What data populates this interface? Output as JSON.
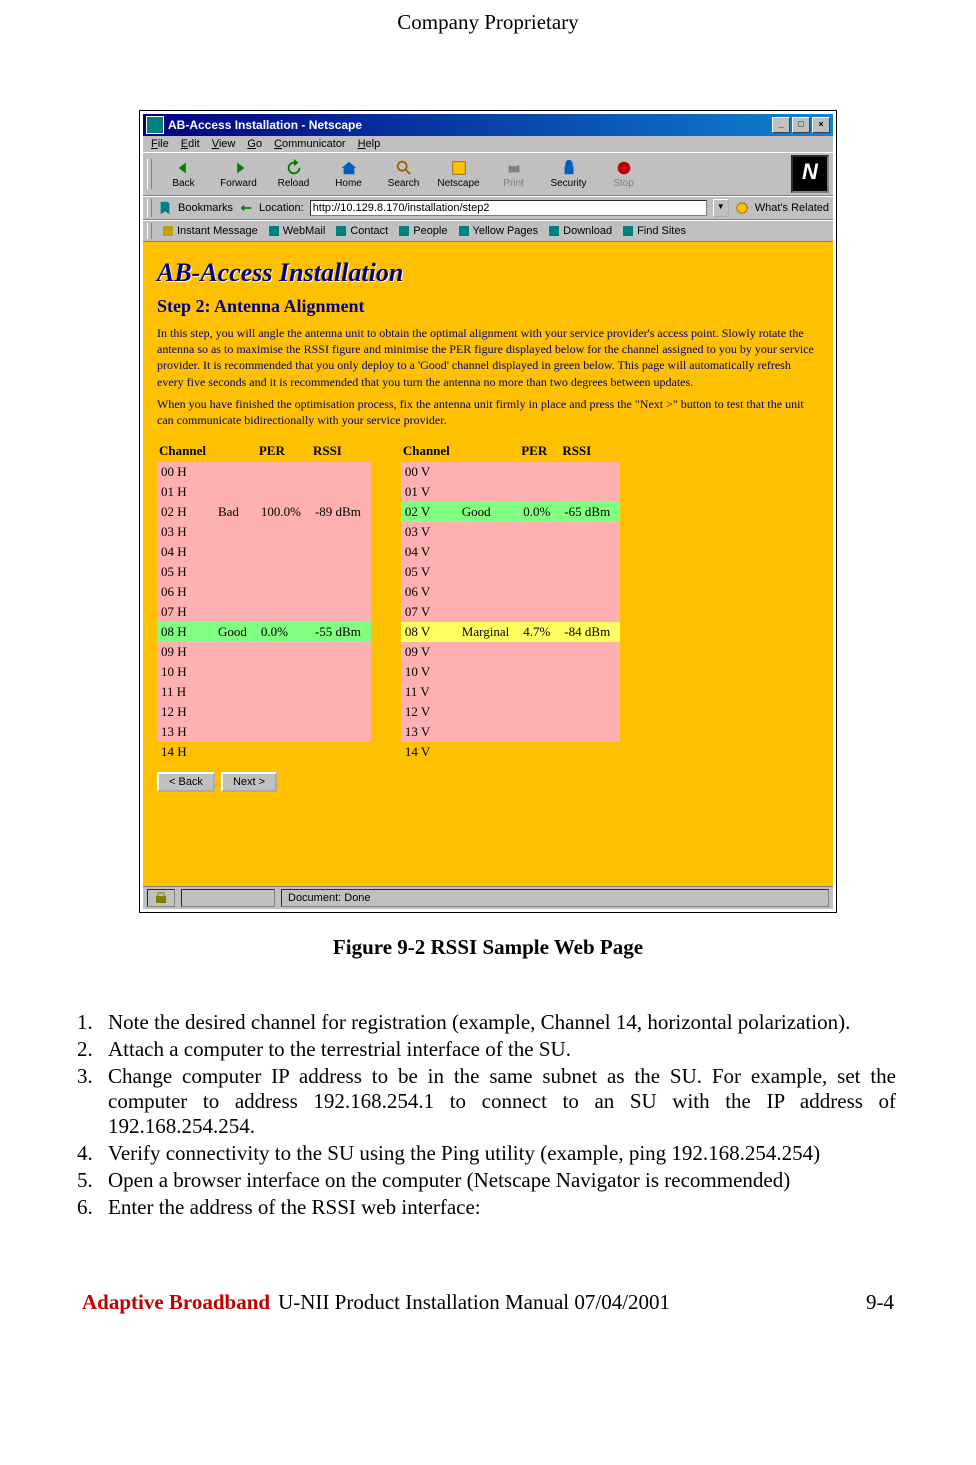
{
  "classification": "Company Proprietary",
  "window": {
    "title": "AB-Access Installation - Netscape",
    "menus": [
      "File",
      "Edit",
      "View",
      "Go",
      "Communicator",
      "Help"
    ],
    "toolbar": [
      {
        "label": "Back",
        "icon": "back"
      },
      {
        "label": "Forward",
        "icon": "forward"
      },
      {
        "label": "Reload",
        "icon": "reload"
      },
      {
        "label": "Home",
        "icon": "home"
      },
      {
        "label": "Search",
        "icon": "search"
      },
      {
        "label": "Netscape",
        "icon": "netscape"
      },
      {
        "label": "Print",
        "icon": "print",
        "disabled": true
      },
      {
        "label": "Security",
        "icon": "security"
      },
      {
        "label": "Stop",
        "icon": "stop",
        "disabled": true
      }
    ],
    "bookmarks_label": "Bookmarks",
    "location_label": "Location:",
    "location_value": "http://10.129.8.170/installation/step2",
    "whats_related": "What's Related",
    "linkbar": [
      "Instant Message",
      "WebMail",
      "Contact",
      "People",
      "Yellow Pages",
      "Download",
      "Find Sites"
    ],
    "status": "Document: Done"
  },
  "content": {
    "h1": "AB-Access Installation",
    "h2": "Step 2: Antenna Alignment",
    "p1": "In this step, you will angle the antenna unit to obtain the optimal alignment with your service provider's access point. Slowly rotate the antenna so as to maximise the RSSI figure and minimise the PER figure displayed below for the channel assigned to you by your service provider. It is recommended that you only deploy to a 'Good' channel displayed in green below. This page will automatically refresh every five seconds and it is recommended that you turn the antenna no more than two degrees between updates.",
    "p2": "When you have finished the optimisation process, fix the antenna unit firmly in place and press the \"Next >\" button to test that the unit can communicate bidirectionally with your service provider.",
    "headers": [
      "Channel",
      "PER",
      "RSSI"
    ],
    "left_rows": [
      {
        "ch": "00 H",
        "q": "",
        "per": "",
        "rssi": "",
        "cls": "pink"
      },
      {
        "ch": "01 H",
        "q": "",
        "per": "",
        "rssi": "",
        "cls": "pink"
      },
      {
        "ch": "02 H",
        "q": "Bad",
        "per": "100.0%",
        "rssi": "-89 dBm",
        "cls": "pink"
      },
      {
        "ch": "03 H",
        "q": "",
        "per": "",
        "rssi": "",
        "cls": "pink"
      },
      {
        "ch": "04 H",
        "q": "",
        "per": "",
        "rssi": "",
        "cls": "pink"
      },
      {
        "ch": "05 H",
        "q": "",
        "per": "",
        "rssi": "",
        "cls": "pink"
      },
      {
        "ch": "06 H",
        "q": "",
        "per": "",
        "rssi": "",
        "cls": "pink"
      },
      {
        "ch": "07 H",
        "q": "",
        "per": "",
        "rssi": "",
        "cls": "pink"
      },
      {
        "ch": "08 H",
        "q": "Good",
        "per": "0.0%",
        "rssi": "-55 dBm",
        "cls": "green"
      },
      {
        "ch": "09 H",
        "q": "",
        "per": "",
        "rssi": "",
        "cls": "pink"
      },
      {
        "ch": "10 H",
        "q": "",
        "per": "",
        "rssi": "",
        "cls": "pink"
      },
      {
        "ch": "11 H",
        "q": "",
        "per": "",
        "rssi": "",
        "cls": "pink"
      },
      {
        "ch": "12 H",
        "q": "",
        "per": "",
        "rssi": "",
        "cls": "pink"
      },
      {
        "ch": "13 H",
        "q": "",
        "per": "",
        "rssi": "",
        "cls": "pink"
      },
      {
        "ch": "14 H",
        "q": "",
        "per": "",
        "rssi": "",
        "cls": ""
      }
    ],
    "right_rows": [
      {
        "ch": "00 V",
        "q": "",
        "per": "",
        "rssi": "",
        "cls": "pink"
      },
      {
        "ch": "01 V",
        "q": "",
        "per": "",
        "rssi": "",
        "cls": "pink"
      },
      {
        "ch": "02 V",
        "q": "Good",
        "per": "0.0%",
        "rssi": "-65 dBm",
        "cls": "green"
      },
      {
        "ch": "03 V",
        "q": "",
        "per": "",
        "rssi": "",
        "cls": "pink"
      },
      {
        "ch": "04 V",
        "q": "",
        "per": "",
        "rssi": "",
        "cls": "pink"
      },
      {
        "ch": "05 V",
        "q": "",
        "per": "",
        "rssi": "",
        "cls": "pink"
      },
      {
        "ch": "06 V",
        "q": "",
        "per": "",
        "rssi": "",
        "cls": "pink"
      },
      {
        "ch": "07 V",
        "q": "",
        "per": "",
        "rssi": "",
        "cls": "pink"
      },
      {
        "ch": "08 V",
        "q": "Marginal",
        "per": "4.7%",
        "rssi": "-84 dBm",
        "cls": "yellow"
      },
      {
        "ch": "09 V",
        "q": "",
        "per": "",
        "rssi": "",
        "cls": "pink"
      },
      {
        "ch": "10 V",
        "q": "",
        "per": "",
        "rssi": "",
        "cls": "pink"
      },
      {
        "ch": "11 V",
        "q": "",
        "per": "",
        "rssi": "",
        "cls": "pink"
      },
      {
        "ch": "12 V",
        "q": "",
        "per": "",
        "rssi": "",
        "cls": "pink"
      },
      {
        "ch": "13 V",
        "q": "",
        "per": "",
        "rssi": "",
        "cls": "pink"
      },
      {
        "ch": "14 V",
        "q": "",
        "per": "",
        "rssi": "",
        "cls": ""
      }
    ],
    "back_btn": "< Back",
    "next_btn": "Next >"
  },
  "caption": "Figure 9-2  RSSI Sample Web Page",
  "instructions": [
    "Note the desired channel for registration (example, Channel 14, horizontal polarization).",
    "Attach a computer to the terrestrial interface of the SU.",
    "Change computer IP address to be in the same subnet as the SU.  For example, set the computer to address 192.168.254.1 to connect to an SU with the IP address of 192.168.254.254.",
    "Verify connectivity to the SU using the Ping utility (example, ping 192.168.254.254)",
    "Open a browser interface on the computer (Netscape Navigator is recommended)",
    "Enter the address of the RSSI web interface:"
  ],
  "footer": {
    "brand": "Adaptive Broadband",
    "doc": "U-NII Product Installation Manual  07/04/2001",
    "page": "9-4"
  }
}
